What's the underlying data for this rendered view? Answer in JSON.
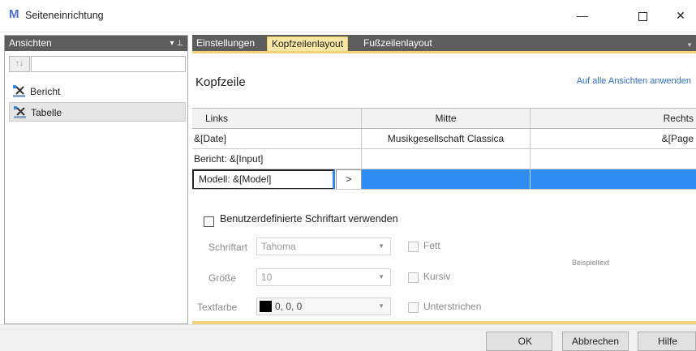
{
  "window": {
    "logo": "M",
    "title": "Seiteneinrichtung",
    "controls": {
      "minimize": "—",
      "close": "✕"
    }
  },
  "left_panel": {
    "header": "Ansichten",
    "header_controls": "▾  ⊥",
    "sort_icon": "↑↓",
    "search_value": "",
    "items": [
      {
        "label": "Bericht",
        "selected": false
      },
      {
        "label": "Tabelle",
        "selected": true
      }
    ]
  },
  "tabs": [
    {
      "label": "Einstellungen",
      "active": false
    },
    {
      "label": "Kopfzeilenlayout",
      "active": true
    },
    {
      "label": "Fußzeilenlayout",
      "active": false
    }
  ],
  "section": {
    "title": "Kopfzeile",
    "apply_all": "Auf alle Ansichten anwenden"
  },
  "grid": {
    "columns": [
      "Links",
      "Mitte",
      "Rechts"
    ],
    "rows": [
      [
        "&[Date]",
        "Musikgesellschaft Classica",
        "&[Page"
      ],
      [
        "Bericht: &[Input]",
        "",
        ""
      ]
    ],
    "editing_row": {
      "value": "Modell: &[Model]",
      "button": ">"
    }
  },
  "font_settings": {
    "custom_font_label": "Benutzerdefinierte Schriftart verwenden",
    "custom_font_checked": false,
    "font_label": "Schriftart",
    "font_value": "Tahoma",
    "size_label": "Größe",
    "size_value": "10",
    "color_label": "Textfarbe",
    "color_value": "0, 0, 0",
    "color_swatch": "#000000",
    "bold_label": "Fett",
    "italic_label": "Kursiv",
    "underline_label": "Unterstrichen",
    "sample_text": "Beispieltext"
  },
  "footer": {
    "ok": "OK",
    "cancel": "Abbrechen",
    "help": "Hilfe"
  },
  "colors": {
    "accent_tab": "#fbe7a6",
    "selection_blue": "#2f8cf0",
    "link": "#2f6fc1",
    "panel_header": "#5d5d5d"
  }
}
